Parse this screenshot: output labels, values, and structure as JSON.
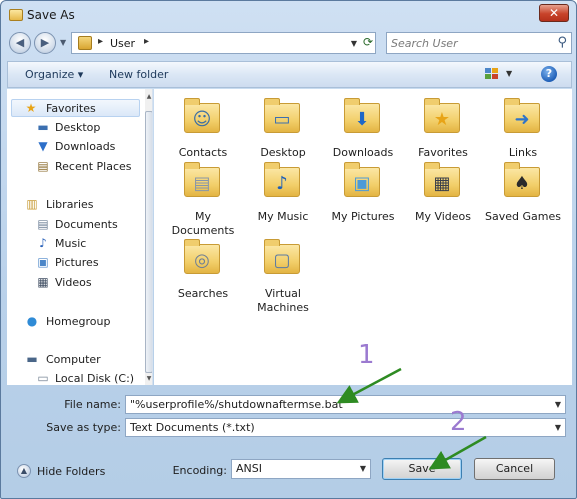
{
  "window": {
    "title": "Save As",
    "close_glyph": "✕"
  },
  "nav": {
    "back_glyph": "◀",
    "forward_glyph": "▶",
    "breadcrumb_sep": "▸",
    "location": "User",
    "search_placeholder": "Search User"
  },
  "toolbar": {
    "organize_label": "Organize ▾",
    "new_folder_label": "New folder",
    "help_glyph": "?"
  },
  "sidebar": {
    "items": [
      {
        "label": "Favorites",
        "icon": "star-icon",
        "glyph": "★",
        "color": "#e8a417"
      },
      {
        "label": "Desktop",
        "icon": "desktop-icon",
        "glyph": "▬",
        "color": "#3b6fb0"
      },
      {
        "label": "Downloads",
        "icon": "downloads-icon",
        "glyph": "▼",
        "color": "#2d6fc9"
      },
      {
        "label": "Recent Places",
        "icon": "recent-places-icon",
        "glyph": "▤",
        "color": "#8a6a2a"
      },
      {
        "label": "Libraries",
        "icon": "libraries-icon",
        "glyph": "▥",
        "color": "#c89b35"
      },
      {
        "label": "Documents",
        "icon": "documents-icon",
        "glyph": "▤",
        "color": "#6d7f96"
      },
      {
        "label": "Music",
        "icon": "music-icon",
        "glyph": "♪",
        "color": "#2860b8"
      },
      {
        "label": "Pictures",
        "icon": "pictures-icon",
        "glyph": "▣",
        "color": "#4c86c8"
      },
      {
        "label": "Videos",
        "icon": "videos-icon",
        "glyph": "▦",
        "color": "#3f4d62"
      },
      {
        "label": "Homegroup",
        "icon": "homegroup-icon",
        "glyph": "●",
        "color": "#2f8bd6"
      },
      {
        "label": "Computer",
        "icon": "computer-icon",
        "glyph": "▬",
        "color": "#4a6688"
      },
      {
        "label": "Local Disk (C:)",
        "icon": "local-disk-icon",
        "glyph": "▭",
        "color": "#7a8797"
      }
    ]
  },
  "content": {
    "items": [
      {
        "label": "Contacts",
        "icon": "contacts-folder-icon",
        "glyph": "☺",
        "color": "#3a6ea5"
      },
      {
        "label": "Desktop",
        "icon": "desktop-folder-icon",
        "glyph": "▭",
        "color": "#3b6fb0"
      },
      {
        "label": "Downloads",
        "icon": "downloads-folder-icon",
        "glyph": "⬇",
        "color": "#1f67c7"
      },
      {
        "label": "Favorites",
        "icon": "favorites-folder-icon",
        "glyph": "★",
        "color": "#e8a417"
      },
      {
        "label": "Links",
        "icon": "links-folder-icon",
        "glyph": "➜",
        "color": "#2f74c9"
      },
      {
        "label": "My Documents",
        "icon": "my-documents-folder-icon",
        "glyph": "▤",
        "color": "#8896a8"
      },
      {
        "label": "My Music",
        "icon": "my-music-folder-icon",
        "glyph": "♪",
        "color": "#1d5fb8"
      },
      {
        "label": "My Pictures",
        "icon": "my-pictures-folder-icon",
        "glyph": "▣",
        "color": "#4c9ad8"
      },
      {
        "label": "My Videos",
        "icon": "my-videos-folder-icon",
        "glyph": "▦",
        "color": "#3a3f4a"
      },
      {
        "label": "Saved Games",
        "icon": "saved-games-folder-icon",
        "glyph": "♠",
        "color": "#2b2b2b"
      },
      {
        "label": "Searches",
        "icon": "searches-folder-icon",
        "glyph": "◎",
        "color": "#6f7f95"
      },
      {
        "label": "Virtual Machines",
        "icon": "virtual-machines-folder-icon",
        "glyph": "▢",
        "color": "#5a7aa3"
      }
    ]
  },
  "form": {
    "file_name_label": "File name:",
    "file_name_value": "\"%userprofile%/shutdownaftermse.bat\"",
    "save_type_label": "Save as type:",
    "save_type_value": "Text Documents (*.txt)",
    "encoding_label": "Encoding:",
    "encoding_value": "ANSI",
    "dropdown_glyph": "▼"
  },
  "footer": {
    "hide_folders_label": "Hide Folders",
    "hide_folders_glyph": "▲",
    "save_label": "Save",
    "cancel_label": "Cancel"
  },
  "annotations": {
    "step1": "1",
    "step2": "2",
    "arrow_color": "#2e8b22",
    "number_color": "#9b7ad0"
  }
}
